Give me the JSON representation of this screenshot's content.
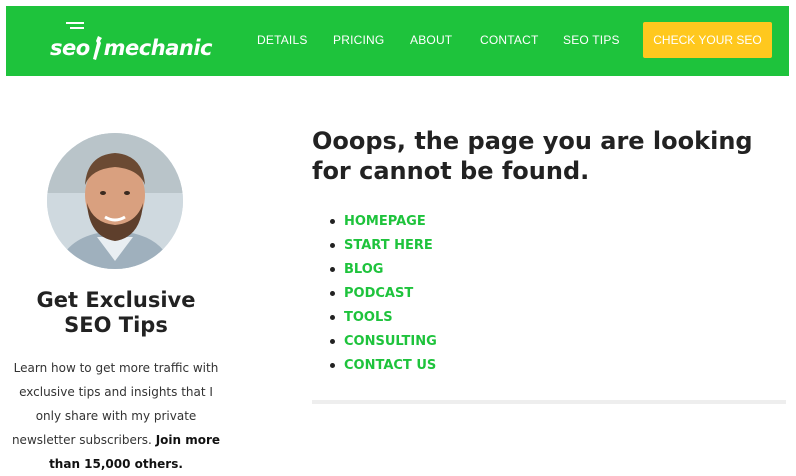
{
  "brand": {
    "logo_text_left": "seo",
    "logo_text_right": "mechanic",
    "accent_color": "#1ec33c",
    "cta_color": "#ffc81e"
  },
  "nav": {
    "items": [
      "DETAILS",
      "PRICING",
      "ABOUT",
      "CONTACT",
      "SEO TIPS"
    ],
    "cta_label": "CHECK YOUR SEO"
  },
  "sidebar": {
    "title": "Get Exclusive SEO Tips",
    "text": "Learn how to get more traffic with exclusive tips and insights that I only share with my private newsletter subscribers.",
    "text_bold": "Join more than 15,000 others."
  },
  "main": {
    "heading": "Ooops, the page you are looking for cannot be found.",
    "links": [
      "HOMEPAGE",
      "START HERE",
      "BLOG",
      "PODCAST",
      "TOOLS",
      "CONSULTING",
      "CONTACT US"
    ]
  }
}
